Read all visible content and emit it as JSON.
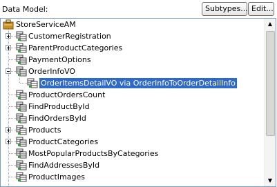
{
  "header": {
    "label": "Data Model:",
    "subtypes_button": "Subtypes...",
    "edit_button": "Edit..."
  },
  "tree": {
    "root": "StoreServiceAM",
    "items": [
      {
        "label": "CustomerRegistration",
        "expander": "plus"
      },
      {
        "label": "ParentProductCategories",
        "expander": "plus"
      },
      {
        "label": "PaymentOptions",
        "expander": "none"
      },
      {
        "label": "OrderInfoVO",
        "expander": "minus"
      },
      {
        "label": "OrderItemsDetailVO via OrderInfoToOrderDetailInfo",
        "expander": "none",
        "child": true,
        "selected": true
      },
      {
        "label": "ProductOrdersCount",
        "expander": "none"
      },
      {
        "label": "FindProductById",
        "expander": "none"
      },
      {
        "label": "FindOrdersById",
        "expander": "none"
      },
      {
        "label": "Products",
        "expander": "plus"
      },
      {
        "label": "ProductCategories",
        "expander": "plus"
      },
      {
        "label": "MostPopularProductsByCategories",
        "expander": "none"
      },
      {
        "label": "FindAddressesById",
        "expander": "none"
      },
      {
        "label": "ProductImages",
        "expander": "none"
      }
    ]
  },
  "colors": {
    "selection": "#316ac5",
    "border": "#7f9db9"
  },
  "icons": {
    "root": "application-module-icon",
    "item": "view-object-instance-icon"
  }
}
